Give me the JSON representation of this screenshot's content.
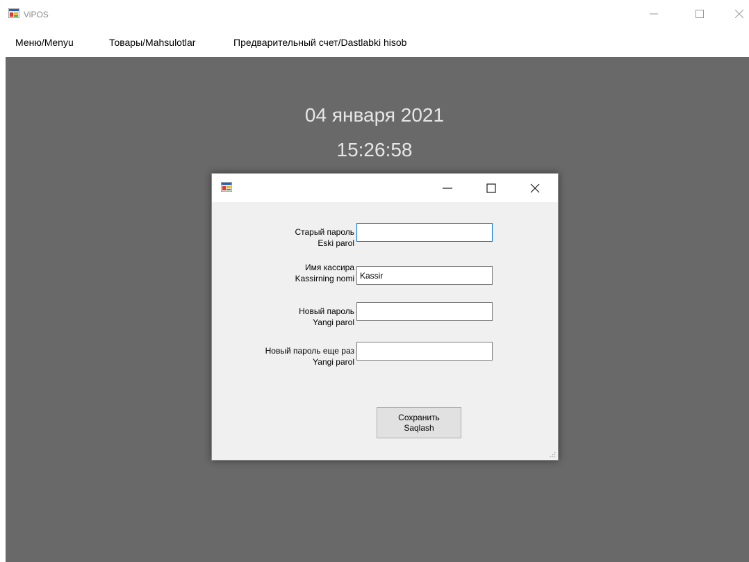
{
  "window": {
    "title": "ViPOS",
    "icon": "app-window-icon",
    "controls": {
      "minimize": "minimize-icon",
      "maximize": "maximize-icon",
      "close": "close-icon"
    }
  },
  "menu": {
    "items": [
      {
        "label": "Меню/Menyu"
      },
      {
        "label": "Товары/Mahsulotlar"
      },
      {
        "label": "Предварительный счет/Dastlabki hisob"
      }
    ]
  },
  "clock": {
    "date": "04 января 2021",
    "time": "15:26:58"
  },
  "dialog": {
    "title": "",
    "fields": [
      {
        "label_ru": "Старый пароль",
        "label_uz": "Eski parol",
        "value": ""
      },
      {
        "label_ru": "Имя кассира",
        "label_uz": "Kassirning nomi",
        "value": "Kassir"
      },
      {
        "label_ru": "Новый пароль",
        "label_uz": "Yangi parol",
        "value": ""
      },
      {
        "label_ru": "Новый пароль еще раз",
        "label_uz": "Yangi parol",
        "value": ""
      }
    ],
    "save_button": {
      "label_ru": "Сохранить",
      "label_uz": "Saqlash"
    }
  },
  "colors": {
    "client_background": "#696969",
    "clock_text": "#e6e6e6",
    "dialog_background": "#f0f0f0",
    "focus_border": "#0078d7"
  }
}
